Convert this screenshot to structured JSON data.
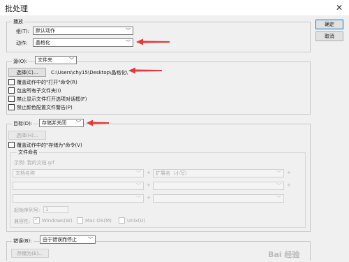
{
  "window": {
    "title": "批处理",
    "close_glyph": "✕"
  },
  "buttons": {
    "ok": "确定",
    "cancel": "取消"
  },
  "play": {
    "legend": "播放",
    "group_label": "组(T):",
    "group_value": "默认动作",
    "action_label": "动作:",
    "action_value": "晶格化"
  },
  "source": {
    "label": "源(O):",
    "value": "文件夹",
    "choose_button": "选择(C)...",
    "path": "C:\\Users\\chy15\\Desktop\\晶格化\\",
    "options": [
      {
        "label": "覆盖动作中的\"打开\"命令(R)"
      },
      {
        "label": "包含所有子文件夹(I)"
      },
      {
        "label": "禁止显示文件打开选项对话框(F)"
      },
      {
        "label": "禁止颜色配置文件警告(P)"
      }
    ]
  },
  "destination": {
    "label": "目标(D):",
    "value": "存储并关闭",
    "choose_button": "选择(H)...",
    "override_label": "覆盖动作中的\"存储为\"命令(V)",
    "naming": {
      "legend": "文件命名",
      "example": "示例: 我的文档.gif",
      "rows": [
        [
          "文档名称",
          "扩展名（小写）"
        ],
        [
          "",
          ""
        ],
        [
          "",
          ""
        ]
      ],
      "plus": "+",
      "start_serial_label": "起始序列号:",
      "start_serial_value": "1",
      "compat_label": "兼容性:",
      "compat_options": [
        {
          "label": "Windows(W)",
          "checked": true
        },
        {
          "label": "Mac OS(M)",
          "checked": false
        },
        {
          "label": "Unix(U)",
          "checked": false
        }
      ]
    }
  },
  "errors": {
    "label": "错误(B):",
    "value": "由于错误而停止",
    "save_as_button": "存储为(E)..."
  },
  "watermark": "Bai 经验",
  "colors": {
    "arrow": "#e53a3a",
    "primary_border": "#0078d7"
  }
}
